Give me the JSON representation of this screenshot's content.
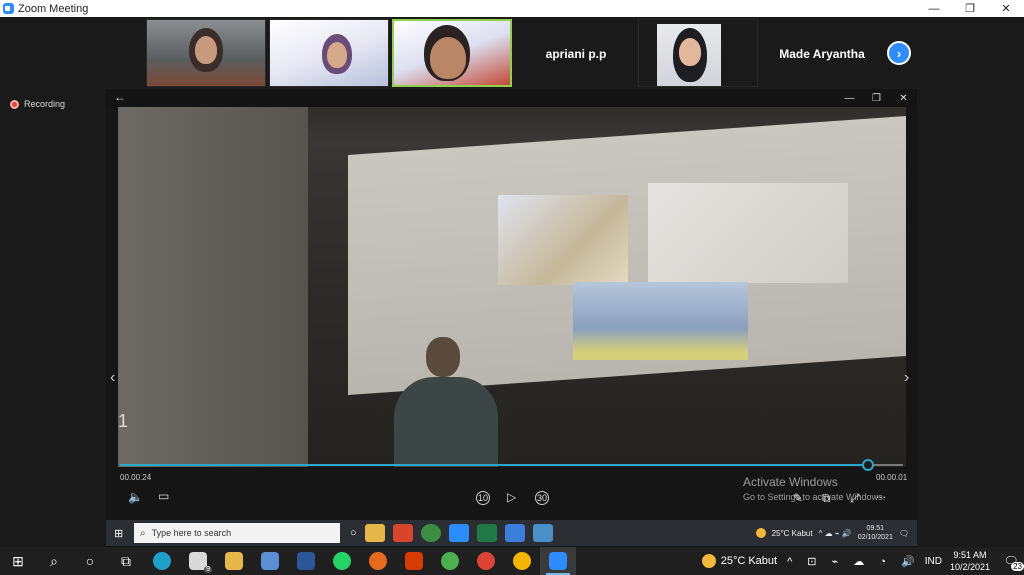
{
  "window": {
    "title": "Zoom Meeting",
    "controls": {
      "minimize": "—",
      "restore": "❐",
      "close": "✕"
    }
  },
  "gallery": {
    "participants": [
      {
        "name": "",
        "has_video": true
      },
      {
        "name": "",
        "has_video": true
      },
      {
        "name": "",
        "has_video": true
      },
      {
        "name": "apriani p.p",
        "has_video": false
      },
      {
        "name": "",
        "has_video": true
      },
      {
        "name": "Made Aryantha",
        "has_video": false
      }
    ],
    "next_icon": "›"
  },
  "recording": {
    "label": "Recording"
  },
  "photos_viewer": {
    "back_icon": "←",
    "controls": {
      "minimize": "—",
      "restore": "❐",
      "close": "✕"
    },
    "photo_number": "1",
    "time_elapsed": "00.00.24",
    "time_remaining": "00.00.01",
    "progress_fraction": 0.955,
    "controls_row": {
      "volume_icon": "🔈",
      "captions_icon": "▭",
      "rewind_label": "10",
      "play_icon": "▷",
      "forward_label": "30",
      "edit_icon": "✎",
      "miniplayer_icon": "⧉",
      "fullscreen_icon": "⤢",
      "more_icon": "..."
    },
    "prev_icon": "‹",
    "next_icon": "›",
    "watermark": {
      "line1": "Activate Windows",
      "line2": "Go to Settings to activate Windows."
    }
  },
  "inner_taskbar": {
    "search_placeholder": "Type here to search",
    "weather": "25°C  Kabut",
    "clock_time": "09.51",
    "clock_date": "02/10/2021"
  },
  "taskbar": {
    "weather": "25°C  Kabut",
    "language": "IND",
    "clock_time": "9:51 AM",
    "clock_date": "10/2/2021",
    "notification_count": "23",
    "mail_badge": "9"
  },
  "colors": {
    "zoom_blue": "#2d8cff",
    "progress": "#2aa7c9",
    "recording_red": "#e0473c"
  }
}
